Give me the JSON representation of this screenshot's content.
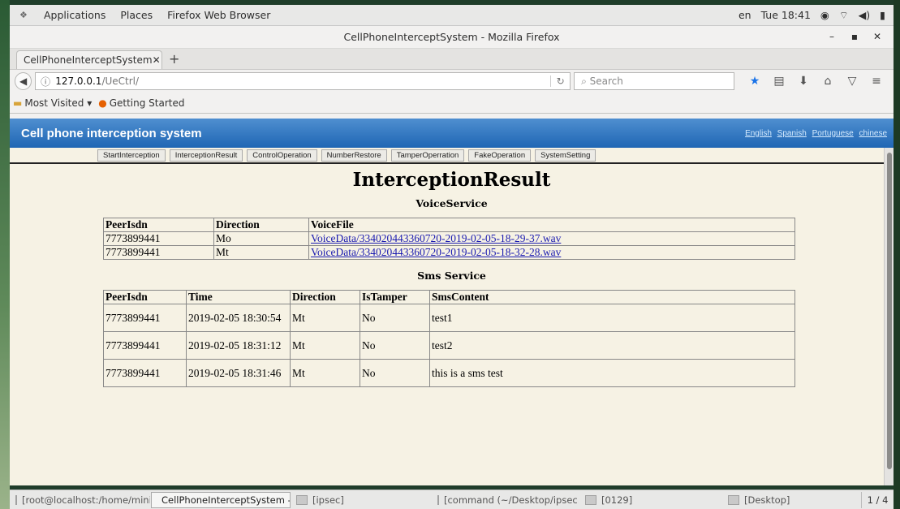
{
  "desktop": {
    "topbar": {
      "applications": "Applications",
      "places": "Places",
      "app_name": "Firefox Web Browser",
      "lang": "en",
      "clock": "Tue 18:41"
    }
  },
  "window": {
    "title": "CellPhoneInterceptSystem - Mozilla Firefox",
    "tab_label": "CellPhoneInterceptSystem",
    "url_host": "127.0.0.1",
    "url_path": "/UeCtrl/",
    "search_placeholder": "Search",
    "bookmarks": [
      "Most Visited",
      "Getting Started"
    ]
  },
  "page": {
    "header_title": "Cell phone interception system",
    "languages": [
      "English",
      "Spanish",
      "Portuguese",
      "chinese"
    ],
    "nav_buttons": [
      "StartInterception",
      "InterceptionResult",
      "ControlOperation",
      "NumberRestore",
      "TamperOperration",
      "FakeOperation",
      "SystemSetting"
    ],
    "heading": "InterceptionResult",
    "voice": {
      "title": "VoiceService",
      "columns": [
        "PeerIsdn",
        "Direction",
        "VoiceFile"
      ],
      "rows": [
        [
          "7773899441",
          "Mo",
          "VoiceData/334020443360720-2019-02-05-18-29-37.wav"
        ],
        [
          "7773899441",
          "Mt",
          "VoiceData/334020443360720-2019-02-05-18-32-28.wav"
        ]
      ]
    },
    "sms": {
      "title": "Sms Service",
      "columns": [
        "PeerIsdn",
        "Time",
        "Direction",
        "IsTamper",
        "SmsContent"
      ],
      "rows": [
        [
          "7773899441",
          "2019-02-05 18:30:54",
          "Mt",
          "No",
          "test1"
        ],
        [
          "7773899441",
          "2019-02-05 18:31:12",
          "Mt",
          "No",
          "test2"
        ],
        [
          "7773899441",
          "2019-02-05 18:31:46",
          "Mt",
          "No",
          "this is a sms test"
        ]
      ]
    }
  },
  "taskbar": {
    "tasks": [
      "[root@localhost:/home/mini...",
      "CellPhoneInterceptSystem - ...",
      "[ipsec]",
      "[command (~/Desktop/ipsec...",
      "[0129]",
      "[Desktop]"
    ],
    "pager": "1 / 4"
  }
}
